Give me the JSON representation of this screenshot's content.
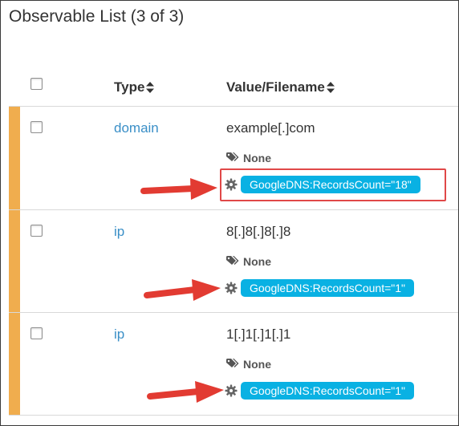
{
  "panel": {
    "title": "Observable List (3 of 3)"
  },
  "table": {
    "headers": {
      "type": "Type",
      "value": "Value/Filename"
    },
    "rows": [
      {
        "type": "domain",
        "value": "example[.]com",
        "tag": "None",
        "enrichment": "GoogleDNS:RecordsCount=\"18\""
      },
      {
        "type": "ip",
        "value": "8[.]8[.]8[.]8",
        "tag": "None",
        "enrichment": "GoogleDNS:RecordsCount=\"1\""
      },
      {
        "type": "ip",
        "value": "1[.]1[.]1[.]1",
        "tag": "None",
        "enrichment": "GoogleDNS:RecordsCount=\"1\""
      }
    ]
  },
  "icons": {
    "sort": "sort-icon",
    "tag": "tag-icon",
    "gear": "gear-icon",
    "arrow": "arrow-annotation"
  },
  "colors": {
    "row_bar": "#f0ad4e",
    "badge": "#09b1e3",
    "link": "#3a8fc7",
    "annotation_red": "#e23b32"
  }
}
